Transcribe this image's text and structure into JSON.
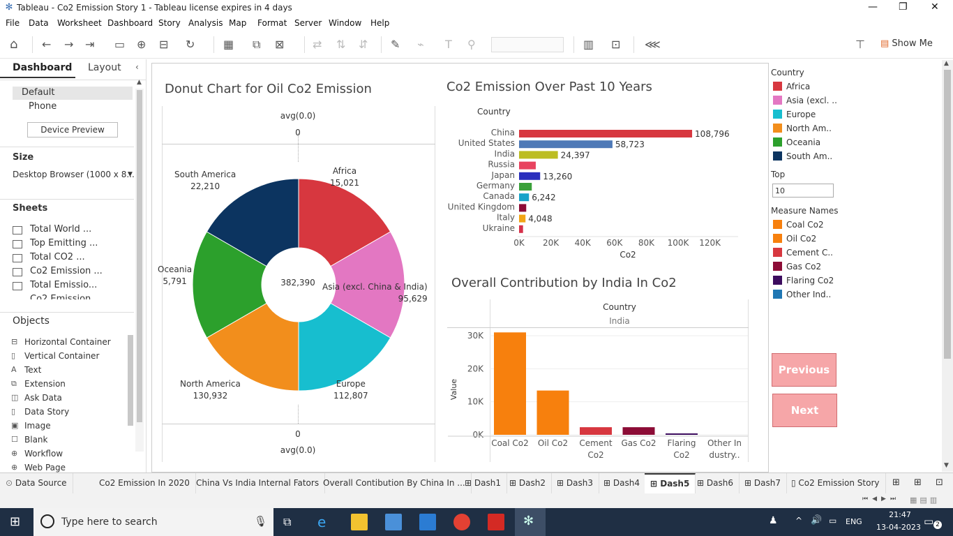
{
  "window": {
    "title": "Tableau - Co2 Emission Story 1 - Tableau license expires in 4 days"
  },
  "menu": [
    "File",
    "Data",
    "Worksheet",
    "Dashboard",
    "Story",
    "Analysis",
    "Map",
    "Format",
    "Server",
    "Window",
    "Help"
  ],
  "toolbar": {
    "show_me": "Show Me"
  },
  "left_panel": {
    "tabs": [
      "Dashboard",
      "Layout"
    ],
    "device": {
      "default": "Default",
      "phone": "Phone",
      "preview_button": "Device Preview"
    },
    "size": {
      "heading": "Size",
      "value": "Desktop Browser (1000 x 8..."
    },
    "sheets": {
      "heading": "Sheets",
      "items": [
        "Total World ...",
        "Top Emitting ...",
        "Total CO2 ...",
        "Co2 Emission ...",
        "Total Emissio...",
        "Co2 Emission"
      ]
    },
    "objects": {
      "heading": "Objects",
      "items": [
        "Horizontal Container",
        "Vertical Container",
        "Text",
        "Extension",
        "Ask Data",
        "Data Story",
        "Image",
        "Blank",
        "Workflow",
        "Web Page"
      ]
    }
  },
  "donut": {
    "title": "Donut Chart for Oil Co2 Emission",
    "top_axis": "avg(0.0)",
    "top_zero": "0",
    "bottom_zero": "0",
    "bottom_axis": "avg(0.0)",
    "center_total": "382,390"
  },
  "bar_top": {
    "title": "Co2 Emission Over Past 10 Years",
    "country_header": "Country"
  },
  "bar_india": {
    "title": "Overall Contribution by India In Co2",
    "country_header": "Country",
    "country": "India"
  },
  "legend": {
    "country_heading": "Country",
    "countries": [
      {
        "label": "Africa",
        "color": "#d7373f"
      },
      {
        "label": "Asia (excl. ..",
        "color": "#e377c2"
      },
      {
        "label": "Europe",
        "color": "#17becf"
      },
      {
        "label": "North Am..",
        "color": "#f28e1c"
      },
      {
        "label": "Oceania",
        "color": "#2ca02c"
      },
      {
        "label": "South Am..",
        "color": "#0c3460"
      }
    ],
    "top_heading": "Top",
    "top_value": "10",
    "measure_heading": "Measure Names",
    "measures": [
      {
        "label": "Coal Co2",
        "color": "#f7800d"
      },
      {
        "label": "Oil Co2",
        "color": "#f7800d"
      },
      {
        "label": "Cement C..",
        "color": "#d7373f"
      },
      {
        "label": "Gas Co2",
        "color": "#8c0c36"
      },
      {
        "label": "Flaring Co2",
        "color": "#3c0c5e"
      },
      {
        "label": "Other Ind..",
        "color": "#1f77b4"
      }
    ]
  },
  "nav": {
    "previous": "Previous",
    "next": "Next"
  },
  "sheet_tabs": [
    "Data Source",
    "Co2 Emission In 2020",
    "China Vs India Internal Fators",
    "Overall Contibution By China In ...",
    "Dash1",
    "Dash2",
    "Dash3",
    "Dash4",
    "Dash5",
    "Dash6",
    "Dash7",
    "Co2 Emission Story"
  ],
  "taskbar": {
    "search_placeholder": "Type here to search",
    "lang": "ENG",
    "time": "21:47",
    "date": "13-04-2023",
    "notif": "2"
  },
  "chart_data": [
    {
      "type": "pie",
      "title": "Donut Chart for Oil Co2 Emission",
      "categories": [
        "Africa",
        "Asia (excl. China & India)",
        "Europe",
        "North America",
        "Oceania",
        "South America"
      ],
      "values": [
        15021,
        95629,
        112807,
        130932,
        5791,
        22210
      ],
      "value_labels": [
        "15,021",
        "95,629",
        "112,807",
        "130,932",
        "5,791",
        "22,210"
      ],
      "colors": [
        "#d7373f",
        "#e377c2",
        "#17becf",
        "#f28e1c",
        "#2ca02c",
        "#0c3460"
      ]
    },
    {
      "type": "bar",
      "title": "Co2 Emission Over Past 10 Years",
      "orientation": "horizontal",
      "categories": [
        "China",
        "United States",
        "India",
        "Russia",
        "Japan",
        "Germany",
        "Canada",
        "United Kingdom",
        "Italy",
        "Ukraine"
      ],
      "values": [
        108796,
        58723,
        24397,
        10500,
        13260,
        8000,
        6242,
        4500,
        4048,
        2500
      ],
      "value_labels": [
        "108,796",
        "58,723",
        "24,397",
        "",
        "13,260",
        "",
        "6,242",
        "",
        "4,048",
        ""
      ],
      "colors": [
        "#d7373f",
        "#4e79b7",
        "#bcbd22",
        "#e8435f",
        "#2a2fbd",
        "#3aa03a",
        "#17a3c9",
        "#8c0c36",
        "#f2a516",
        "#d6304a"
      ],
      "xlabel": "Co2",
      "ylabel": "Country",
      "xlim": [
        0,
        120000
      ],
      "xticks": [
        "0K",
        "20K",
        "40K",
        "60K",
        "80K",
        "100K",
        "120K"
      ]
    },
    {
      "type": "bar",
      "title": "Overall Contribution by India In Co2",
      "categories": [
        "Coal Co2",
        "Oil Co2",
        "Cement Co2",
        "Gas Co2",
        "Flaring Co2",
        "Other Industry.."
      ],
      "category_labels": [
        [
          "Coal Co2"
        ],
        [
          "Oil Co2"
        ],
        [
          "Cement",
          "Co2"
        ],
        [
          "Gas Co2"
        ],
        [
          "Flaring",
          "Co2"
        ],
        [
          "Other In",
          "dustry.."
        ]
      ],
      "values": [
        31000,
        13400,
        2300,
        2300,
        300,
        0
      ],
      "colors": [
        "#f7800d",
        "#f7800d",
        "#d7373f",
        "#8c0c36",
        "#3c0c5e",
        "#1f77b4"
      ],
      "ylabel": "Value",
      "ylim": [
        0,
        33000
      ],
      "yticks": [
        "0K",
        "10K",
        "20K",
        "30K"
      ]
    }
  ]
}
